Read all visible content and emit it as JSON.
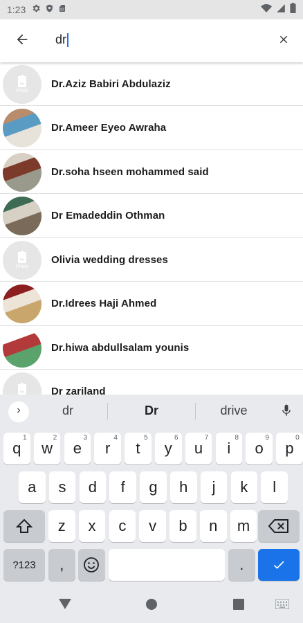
{
  "status_bar": {
    "time": "1:23",
    "left_icons": [
      "gear-icon",
      "shield-icon",
      "sim-card-icon"
    ],
    "right_icons": [
      "wifi-icon",
      "signal-icon",
      "battery-icon"
    ]
  },
  "search": {
    "value": "dr"
  },
  "results": [
    {
      "name": "Dr.Aziz Babiri Abdulaziz",
      "avatar": "placeholder",
      "placeholder_label": "Photo"
    },
    {
      "name": "Dr.Ameer Eyeo Awraha",
      "avatar": "photo",
      "colors": [
        "#b98c6d",
        "#5a9bc4",
        "#e8e3da"
      ]
    },
    {
      "name": "Dr.soha hseen mohammed said",
      "avatar": "photo",
      "colors": [
        "#d9d0c5",
        "#7c3a2a",
        "#9a9a8c"
      ]
    },
    {
      "name": "Dr Emadeddin Othman",
      "avatar": "photo",
      "colors": [
        "#3e6b54",
        "#d7d0c4",
        "#7a6a5a"
      ]
    },
    {
      "name": "Olivia wedding dresses",
      "avatar": "placeholder",
      "placeholder_label": "Photo"
    },
    {
      "name": "Dr.Idrees Haji Ahmed",
      "avatar": "photo",
      "colors": [
        "#8c1f1f",
        "#ece4d6",
        "#c9a66b"
      ]
    },
    {
      "name": "Dr.hiwa abdullsalam younis",
      "avatar": "photo",
      "colors": [
        "#ffffff",
        "#b33a3a",
        "#5aa36c"
      ]
    },
    {
      "name": "Dr zariland",
      "avatar": "placeholder",
      "placeholder_label": "Photo"
    }
  ],
  "keyboard": {
    "suggestions": [
      "dr",
      "Dr",
      "drive"
    ],
    "row1": [
      {
        "key": "q",
        "hint": "1"
      },
      {
        "key": "w",
        "hint": "2"
      },
      {
        "key": "e",
        "hint": "3"
      },
      {
        "key": "r",
        "hint": "4"
      },
      {
        "key": "t",
        "hint": "5"
      },
      {
        "key": "y",
        "hint": "6"
      },
      {
        "key": "u",
        "hint": "7"
      },
      {
        "key": "i",
        "hint": "8"
      },
      {
        "key": "o",
        "hint": "9"
      },
      {
        "key": "p",
        "hint": "0"
      }
    ],
    "row2": [
      "a",
      "s",
      "d",
      "f",
      "g",
      "h",
      "j",
      "k",
      "l"
    ],
    "row3": [
      "z",
      "x",
      "c",
      "v",
      "b",
      "n",
      "m"
    ],
    "symbols_label": "?123",
    "comma_label": ",",
    "period_label": "."
  },
  "colors": {
    "accent": "#1a73e8",
    "keyboard_bg": "#e8eaed"
  }
}
